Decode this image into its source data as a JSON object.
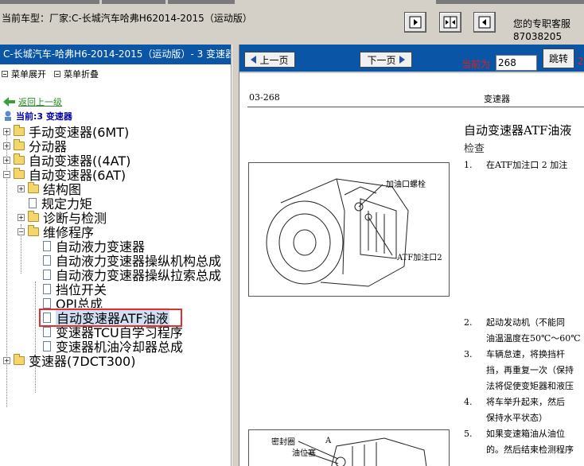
{
  "top": {
    "car_title": "当前车型：厂家:C-长城汽车哈弗H62014-2015（运动版）",
    "service_line1": "您的专职客服",
    "service_line2": "87038205"
  },
  "left": {
    "header": "C-长城汽车-哈弗H6-2014-2015（运动版）- 3 变速器.",
    "expand_all": "菜单展开",
    "collapse_all": "菜单折叠",
    "back_link": "返回上一级",
    "current": "当前:3 变速器",
    "tree": [
      {
        "label": "手动变速器(6MT)"
      },
      {
        "label": "分动器"
      },
      {
        "label": "自动变速器((4AT)"
      },
      {
        "label": "自动变速器(6AT)"
      },
      {
        "label": "结构图"
      },
      {
        "label": "规定力矩"
      },
      {
        "label": "诊断与检测"
      },
      {
        "label": "维修程序"
      },
      {
        "label": "自动液力变速器"
      },
      {
        "label": "自动液力变速器操纵机构总成"
      },
      {
        "label": "自动液力变速器操纵拉索总成"
      },
      {
        "label": "挡位开关"
      },
      {
        "label": "OPI总成"
      },
      {
        "label": "自动变速器ATF油液"
      },
      {
        "label": "变速器TCU自学习程序"
      },
      {
        "label": "变速器机油冷却器总成"
      },
      {
        "label": "变速器(7DCT300)"
      }
    ]
  },
  "right": {
    "prev_page": "上一页",
    "next_page": "下一页",
    "current_page_label": "当前为",
    "current_page_value": "268",
    "jump": "跳转",
    "jump_extra": "2",
    "page_num": "03-268",
    "page_section": "变速器",
    "doc_title": "自动变速器ATF油液",
    "doc_sub": "检查",
    "steps": [
      {
        "n": "1.",
        "lines": [
          "在ATF加注口 2 加注"
        ]
      },
      {
        "n": "2.",
        "lines": [
          "起动发动机（不能同",
          "油温温度在50℃～60℃"
        ]
      },
      {
        "n": "3.",
        "lines": [
          "车辆怠速，将换挡杆",
          "挡，再重复一次（保持",
          "法将促使变矩器和液压"
        ]
      },
      {
        "n": "4.",
        "lines": [
          "将车举升起来，然后",
          "保持水平状态）"
        ]
      },
      {
        "n": "5.",
        "lines": [
          "如果变速箱油从油位",
          "的。然后结束检测程序"
        ]
      }
    ],
    "fig1_label1": "加油口螺栓",
    "fig1_label2": "ATF加注口2",
    "fig2_label1": "密封圈",
    "fig2_label2": "油位塞",
    "fig2_label3": "A"
  }
}
